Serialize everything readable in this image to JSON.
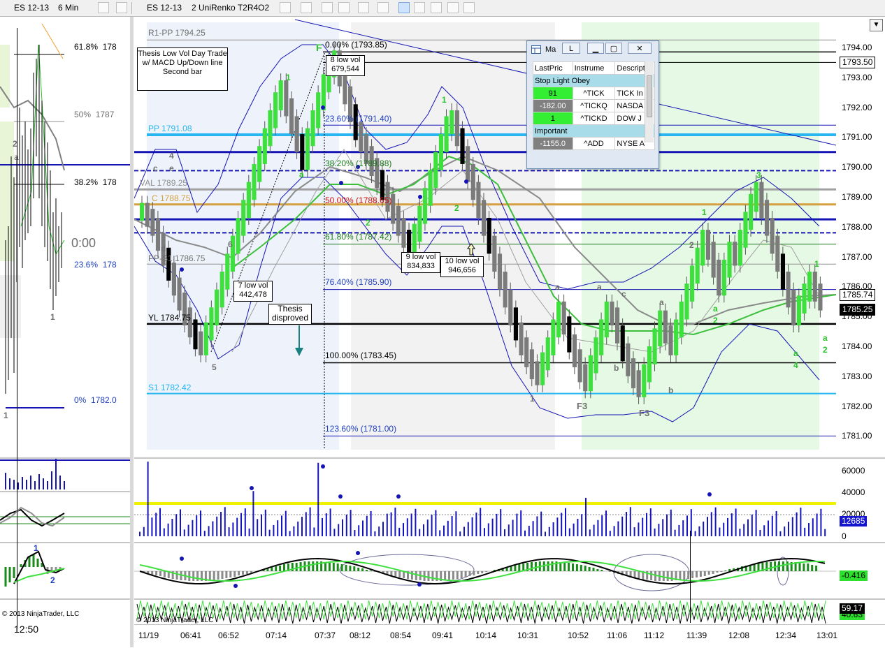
{
  "left_chart": {
    "symbol": "ES 12-13",
    "interval": "6 Min",
    "fib_levels": [
      {
        "label": "61.8%",
        "value": "178"
      },
      {
        "label": "50%",
        "value": "1787"
      },
      {
        "label": "38.2%",
        "value": "178"
      },
      {
        "label": "23.6%",
        "value": "178"
      },
      {
        "label": "0%",
        "value": "1782.0"
      }
    ],
    "timer": "0:00",
    "labels": [
      "2",
      "a",
      "1",
      "1",
      "2"
    ],
    "copyright": "© 2013 NinjaTrader, LLC",
    "time_label": "12:50"
  },
  "main_chart": {
    "symbol": "ES 12-13",
    "interval": "2 UniRenko T2R4O2",
    "copyright": "© 2013 NinjaTrader, LLC",
    "price_axis": [
      "1794.00",
      "1793.00",
      "1792.00",
      "1791.00",
      "1790.00",
      "1789.00",
      "1788.00",
      "1787.00",
      "1786.00",
      "1785.00",
      "1784.00",
      "1783.00",
      "1782.00",
      "1781.00"
    ],
    "price_flags": [
      {
        "text": "1793.50",
        "bg": "#ffffff",
        "fg": "#000000",
        "border": "#000000"
      },
      {
        "text": "1785.74",
        "bg": "#ffffff",
        "fg": "#000000",
        "border": "#000000"
      },
      {
        "text": "1785.25",
        "bg": "#000000",
        "fg": "#ffffff",
        "border": "#000000"
      }
    ],
    "level_labels": {
      "r1pp": "R1-PP 1794.25",
      "pp": "PP 1791.08",
      "val": "VAL 1789.25",
      "c": "C 1788.75",
      "pps1": "PP-S1 1786.75",
      "yl": "YL 1784.75",
      "s1": "S1 1782.42"
    },
    "fib_labels": [
      {
        "text": "0.00% (1793.85)",
        "color": "#000000"
      },
      {
        "text": "23.60% (1791.40)",
        "color": "#1f3fbf"
      },
      {
        "text": "38.20% (1789.88)",
        "color": "#1a7a1a"
      },
      {
        "text": "50.00% (1788.65)",
        "color": "#d01010"
      },
      {
        "text": "61.80% (1787.42)",
        "color": "#1a7a1a"
      },
      {
        "text": "76.40% (1785.90)",
        "color": "#1f3fbf"
      },
      {
        "text": "100.00% (1783.45)",
        "color": "#000000"
      },
      {
        "text": "123.60% (1781.00)",
        "color": "#1f3fbf"
      }
    ],
    "notes": {
      "thesis": "Thesis Low Vol Day Trade w/ MACD Up/Down line Second bar",
      "disproved": "Thesis disproved",
      "lv7": "7 low vol 442,478",
      "lv8": "8 low vol 679,544",
      "lv9": "9 low vol 834,833",
      "lv10": "10 low vol 946,656"
    },
    "wave_labels": {
      "c": "c",
      "e": "e",
      "four": "4",
      "d": "d",
      "five": "5",
      "six": "6",
      "F": "F",
      "one_a": "1",
      "a_green": "a",
      "one_b": "1",
      "two_a": "2",
      "two_b": "2",
      "a1": "a",
      "a2": "a",
      "c2": "c",
      "b1": "b",
      "a3": "a",
      "b2": "b",
      "one_c": "1",
      "F3a": "F3",
      "F3b": "F3",
      "two_c": "2",
      "one_d": "1",
      "three": "3",
      "a_g2": "a",
      "two_g": "2",
      "one_g2": "1",
      "a_g3": "a",
      "four_g": "4",
      "a_g4": "a",
      "two_g2": "2"
    },
    "volume_axis": [
      "60000",
      "40000",
      "20000",
      "0"
    ],
    "volume_flag": "12685",
    "macd_flag": "-0.416",
    "osc_flag": "59.17",
    "osc_flag2": "40.63",
    "time_axis": [
      "11/19",
      "06:41",
      "06:52",
      "07:14",
      "07:37",
      "08:12",
      "08:54",
      "09:41",
      "10:14",
      "10:31",
      "10:52",
      "11:06",
      "11:12",
      "11:39",
      "12:08",
      "12:34",
      "13:01"
    ]
  },
  "market_window": {
    "title": "Ma",
    "tab": "L",
    "columns": [
      "LastPric",
      "Instrume",
      "Descripti"
    ],
    "groups": [
      {
        "name": "Stop Light Obey",
        "rows": [
          {
            "last": "91",
            "instrument": "^TICK",
            "desc": "TICK In",
            "bg": "#33ee33"
          },
          {
            "last": "-182.00",
            "instrument": "^TICKQ",
            "desc": "NASDA",
            "bg": "#808080"
          },
          {
            "last": "1",
            "instrument": "^TICKD",
            "desc": "DOW J",
            "bg": "#33ee33"
          }
        ]
      },
      {
        "name": "Important",
        "rows": [
          {
            "last": "-1155.0",
            "instrument": "^ADD",
            "desc": "NYSE A",
            "bg": "#808080"
          }
        ]
      }
    ]
  },
  "colors": {
    "pp": "#27b6f0",
    "blue_line": "#1515b5",
    "val": "#a0a0a0",
    "c_line": "#d4a040",
    "green_bar": "#3ee03e",
    "gray_bar": "#7b7b7b",
    "black_bar": "#000000",
    "yellow": "#f0f000"
  }
}
